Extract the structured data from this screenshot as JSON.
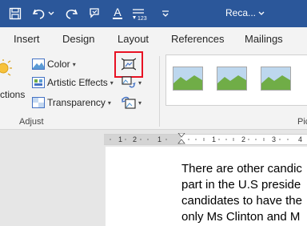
{
  "titlebar": {
    "title": "Reca...",
    "text_color_letter": "A",
    "numbering_label": "123",
    "bg_color": "#2b579a"
  },
  "tabs": [
    "Insert",
    "Design",
    "Layout",
    "References",
    "Mailings"
  ],
  "ribbon": {
    "partial_left_label": "ctions",
    "color_label": "Color",
    "artistic_label": "Artistic Effects",
    "transparency_label": "Transparency",
    "group_label": "Adjust",
    "partial_right_label": "Pic",
    "highlight_color": "#e81123"
  },
  "ruler": {
    "numbers": [
      "1",
      "2",
      "1",
      "1",
      "2",
      "3",
      "4"
    ]
  },
  "document": {
    "lines": [
      "There are other candic",
      "part in the U.S preside",
      "candidates to have the",
      "only Ms Clinton and M"
    ]
  }
}
